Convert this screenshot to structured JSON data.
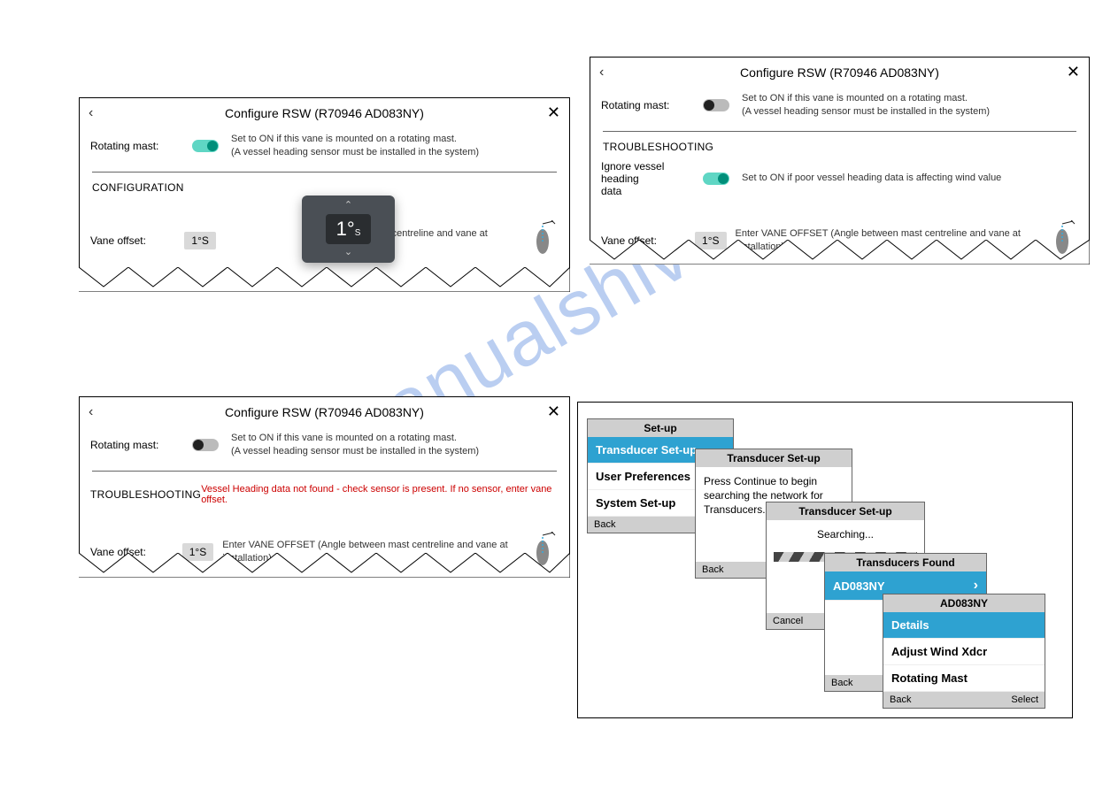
{
  "watermark": "manualshive.com",
  "p1": {
    "title": "Configure RSW (R70946 AD083NY)",
    "rotating_label": "Rotating mast:",
    "rotating_desc_l1": "Set to ON if this vane is mounted on a rotating mast.",
    "rotating_desc_l2": "(A vessel heading sensor must be installed in the system)",
    "config_section": "CONFIGURATION",
    "vane_label": "Vane offset:",
    "vane_val": "1°S",
    "vane_desc": "e between mast centreline and vane at installation)",
    "spinner": "1°",
    "spinner_sub": "S"
  },
  "p2": {
    "title": "Configure RSW (R70946 AD083NY)",
    "rotating_label": "Rotating mast:",
    "rotating_desc_l1": "Set to ON if this vane is mounted on a rotating mast.",
    "rotating_desc_l2": "(A vessel heading sensor must be installed in the system)",
    "ts_section": "TROUBLESHOOTING",
    "ignore_label_l1": "Ignore vessel heading",
    "ignore_label_l2": "data",
    "ignore_desc": "Set to ON if poor vessel heading data is affecting wind value",
    "vane_label": "Vane offset:",
    "vane_val": "1°S",
    "vane_desc": "Enter VANE OFFSET (Angle between mast centreline and vane at installation)"
  },
  "p3": {
    "title": "Configure RSW (R70946 AD083NY)",
    "rotating_label": "Rotating mast:",
    "rotating_desc_l1": "Set to ON if this vane is mounted on a rotating mast.",
    "rotating_desc_l2": "(A vessel heading sensor must be installed in the system)",
    "ts_section": "TROUBLESHOOTING",
    "err": "Vessel Heading data not found - check sensor is present. If no sensor, enter vane offset.",
    "vane_label": "Vane offset:",
    "vane_val": "1°S",
    "vane_desc": "Enter VANE OFFSET (Angle between mast centreline and vane at installation)"
  },
  "c1": {
    "hdr": "Set-up",
    "i1": "Transducer Set-up",
    "i2": "User Preferences",
    "i3": "System Set-up",
    "back": "Back"
  },
  "c2": {
    "hdr": "Transducer Set-up",
    "body_l1": "Press Continue to begin",
    "body_l2": "searching the network for",
    "body_l3": "Transducers.",
    "back": "Back"
  },
  "c3": {
    "hdr": "Transducer Set-up",
    "body": "Searching...",
    "cancel": "Cancel"
  },
  "c4": {
    "hdr": "Transducers Found",
    "item": "AD083NY",
    "back": "Back"
  },
  "c5": {
    "hdr": "AD083NY",
    "i1": "Details",
    "i2": "Adjust Wind Xdcr",
    "i3": "Rotating Mast",
    "back": "Back",
    "select": "Select"
  }
}
